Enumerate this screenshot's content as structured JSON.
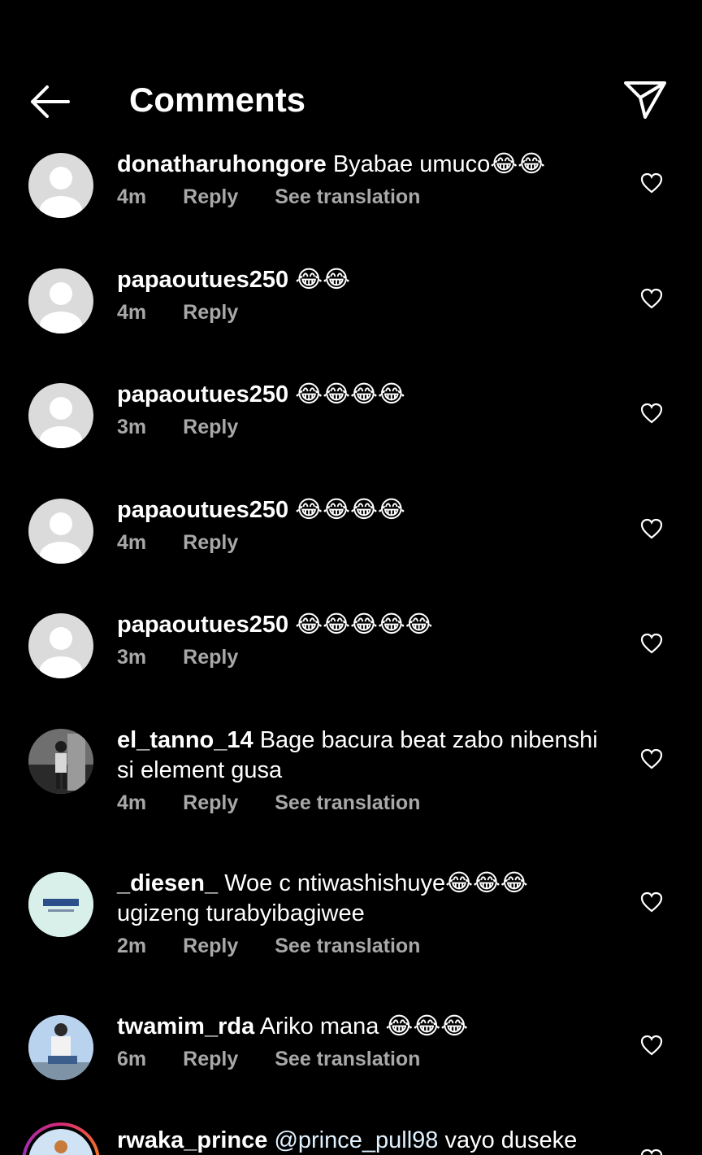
{
  "header": {
    "title": "Comments"
  },
  "comments": [
    {
      "username": "donatharuhongore",
      "text": "Byabae umuco😂😂",
      "time": "4m",
      "reply": "Reply",
      "translate": "See translation",
      "avatar": "default-avatar"
    },
    {
      "username": "papaoutues250",
      "text": "😂😂",
      "time": "4m",
      "reply": "Reply",
      "avatar": "default-avatar"
    },
    {
      "username": "papaoutues250",
      "text": "😂😂😂😂",
      "time": "3m",
      "reply": "Reply",
      "avatar": "default-avatar"
    },
    {
      "username": "papaoutues250",
      "text": "😂😂😂😂",
      "time": "4m",
      "reply": "Reply",
      "avatar": "default-avatar"
    },
    {
      "username": "papaoutues250",
      "text": "😂😂😂😂😂",
      "time": "3m",
      "reply": "Reply",
      "avatar": "default-avatar"
    },
    {
      "username": "el_tanno_14",
      "text": "Bage bacura beat zabo nibenshi si element gusa",
      "time": "4m",
      "reply": "Reply",
      "translate": "See translation",
      "avatar": "photo-avatar"
    },
    {
      "username": "_diesen_",
      "text": "Woe c ntiwashishuye😂😂😂 ugizeng turabyibagiwee",
      "time": "2m",
      "reply": "Reply",
      "translate": "See translation",
      "avatar": "logo-avatar"
    },
    {
      "username": "twamim_rda",
      "text": "Ariko mana 😂😂😂",
      "time": "6m",
      "reply": "Reply",
      "translate": "See translation",
      "avatar": "photo-avatar"
    },
    {
      "username": "rwaka_prince",
      "mention": "@prince_pull98",
      "text": "vayo duseke",
      "avatar": "story-avatar"
    }
  ],
  "colors": {
    "background": "#000000",
    "text": "#ffffff",
    "meta": "#a8a8a8",
    "avatar_placeholder": "#dbdbdb"
  },
  "icons": {
    "back": "back-arrow-icon",
    "share": "send-icon",
    "like": "heart-icon"
  }
}
